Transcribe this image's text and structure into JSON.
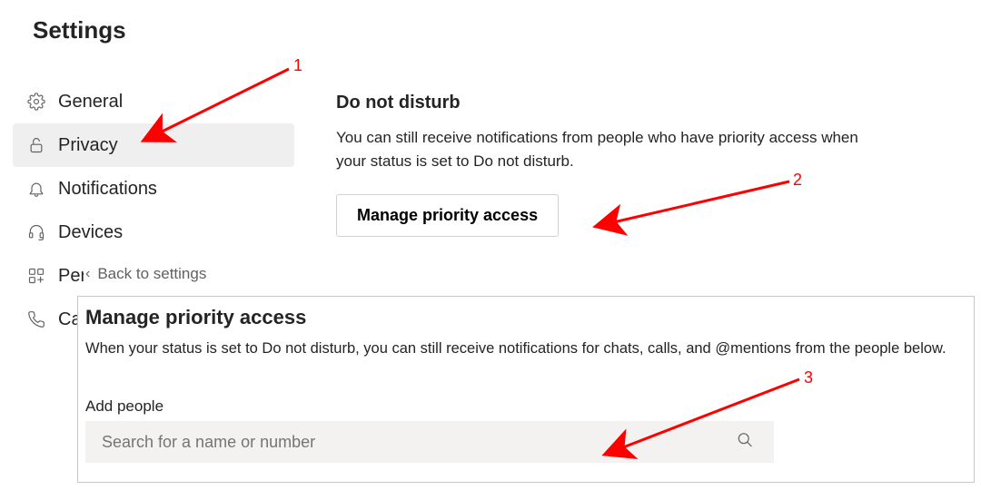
{
  "title": "Settings",
  "sidebar": {
    "items": [
      {
        "label": "General"
      },
      {
        "label": "Privacy"
      },
      {
        "label": "Notifications"
      },
      {
        "label": "Devices"
      },
      {
        "label": "Permissions"
      },
      {
        "label": "Calls"
      }
    ]
  },
  "back": {
    "label": "Back to settings"
  },
  "main": {
    "heading": "Do not disturb",
    "desc": "You can still receive notifications from people who have priority access when your status is set to Do not disturb.",
    "manage_btn": "Manage priority access"
  },
  "panel": {
    "title": "Manage priority access",
    "desc": "When your status is set to Do not disturb, you can still receive notifications for chats, calls, and @mentions from the people below.",
    "add_label": "Add people",
    "search_placeholder": "Search for a name or number"
  },
  "annotations": {
    "n1": "1",
    "n2": "2",
    "n3": "3"
  }
}
